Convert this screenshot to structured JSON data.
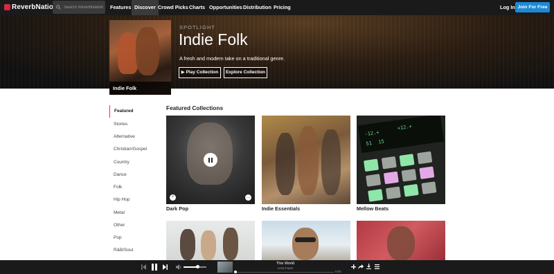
{
  "nav": {
    "logo": "ReverbNation",
    "search_placeholder": "Search ReverbNation",
    "links": [
      "Features",
      "Discover",
      "Crowd Picks",
      "Charts",
      "Opportunities",
      "Distribution",
      "Pricing"
    ],
    "active_link": "Discover",
    "login": "Log In",
    "join": "Join For Free"
  },
  "hero": {
    "thumb_label": "Indie Folk",
    "eyebrow": "SPOTLIGHT",
    "title": "Indie Folk",
    "subtitle": "A fresh and modern take on a traditional genre.",
    "play_button": "▶ Play Collection",
    "explore_button": "Explore Collection"
  },
  "sidebar": {
    "items": [
      "Featured",
      "Stories",
      "Alternative",
      "Christian/Gospel",
      "Country",
      "Dance",
      "Folk",
      "Hip Hop",
      "Metal",
      "Other",
      "Pop",
      "R&B/Soul"
    ],
    "active": "Featured"
  },
  "collections": {
    "title": "Featured Collections",
    "items": [
      "Dark Pop",
      "Indie Essentials",
      "Mellow Beats"
    ]
  },
  "player": {
    "track_title": "This World",
    "track_artist": "Lena Fayre",
    "time": "0:00",
    "volume": 0.6,
    "progress": 0.0
  },
  "colors": {
    "nav_bg": "#1a1a1a",
    "accent_red": "#e4342e",
    "join_blue": "#1e88d3"
  }
}
